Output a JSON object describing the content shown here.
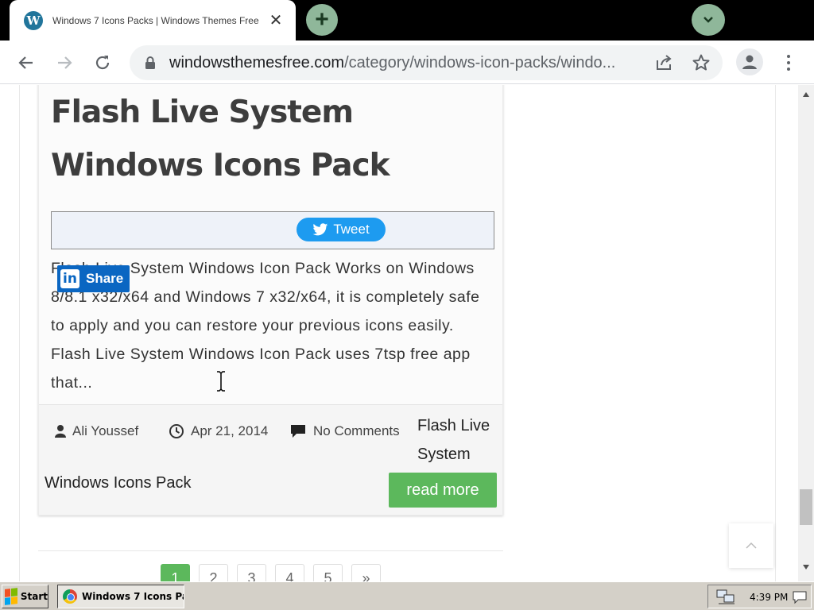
{
  "browser": {
    "tab": {
      "favicon": "W",
      "title": "Windows 7 Icons Packs | Windows Themes Free"
    },
    "address": {
      "host": "windowsthemesfree.com",
      "path": "/category/windows-icon-packs/windo..."
    }
  },
  "icons": {
    "favicon": "wordpress-icon",
    "new_tab": "plus-icon",
    "tab_search": "chevron-down-icon",
    "back": "back-arrow-icon",
    "forward": "forward-arrow-icon",
    "reload": "reload-icon",
    "lock": "lock-icon",
    "share": "share-icon",
    "bookmark": "star-icon",
    "profile": "person-icon",
    "menu": "kebab-menu-icon"
  },
  "post": {
    "title": "Flash Live System Windows Icons Pack",
    "tweet_label": "Tweet",
    "linkedin_label": "Share",
    "excerpt": "Flash Live System Windows Icon Pack Works on Windows 8/8.1 x32/x64 and Windows 7 x32/x64, it is completely safe to apply and you can restore your previous icons easily. Flash Live System Windows Icon Pack uses 7tsp free app that...",
    "author": "Ali Youssef",
    "date": "Apr 21, 2014",
    "comments": "No Comments",
    "category_line1": "Flash Live",
    "category_line2": "System",
    "category_line3": "Windows Icons Pack",
    "read_more": "read more"
  },
  "pagination": {
    "pages": [
      "1",
      "2",
      "3",
      "4",
      "5"
    ],
    "next": "»",
    "current": "1"
  },
  "colors": {
    "accent_green": "#5cb85c",
    "twitter_blue": "#1d9bf0",
    "linkedin_blue": "#0a66c2",
    "tabstrip": "#000000"
  },
  "taskbar": {
    "start_label": "Start",
    "window_button": "Windows 7 Icons Pac...",
    "clock": "4:39 PM"
  }
}
